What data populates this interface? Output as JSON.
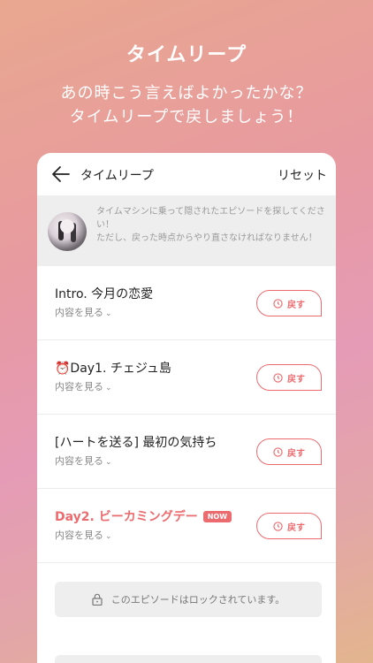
{
  "promo": {
    "title": "タイムリープ",
    "line1": "あの時こう言えばよかったかな？",
    "line2": "タイムリープで戻しましょう！"
  },
  "header": {
    "title": "タイムリープ",
    "reset_label": "リセット"
  },
  "notice": {
    "line1": "タイムマシンに乗って隠されたエピソードを探してください！",
    "line2": "ただし、戻った時点からやり直さなければなりません！"
  },
  "episodes": [
    {
      "title": "Intro. 今月の恋愛",
      "more": "内容を見る",
      "button": "戻す"
    },
    {
      "title": "⏰Day1. チェジュ島",
      "more": "内容を見る",
      "button": "戻す"
    },
    {
      "title": "[ハートを送る] 最初の気持ち",
      "more": "内容を見る",
      "button": "戻す"
    },
    {
      "title": "Day2. ビーカミングデー",
      "badge": "NOW",
      "more": "内容を見る",
      "button": "戻す"
    }
  ],
  "locked": {
    "text": "このエピソードはロックされています。"
  },
  "colors": {
    "accent": "#ec6b6f",
    "notice_bg": "#eeeeee"
  }
}
